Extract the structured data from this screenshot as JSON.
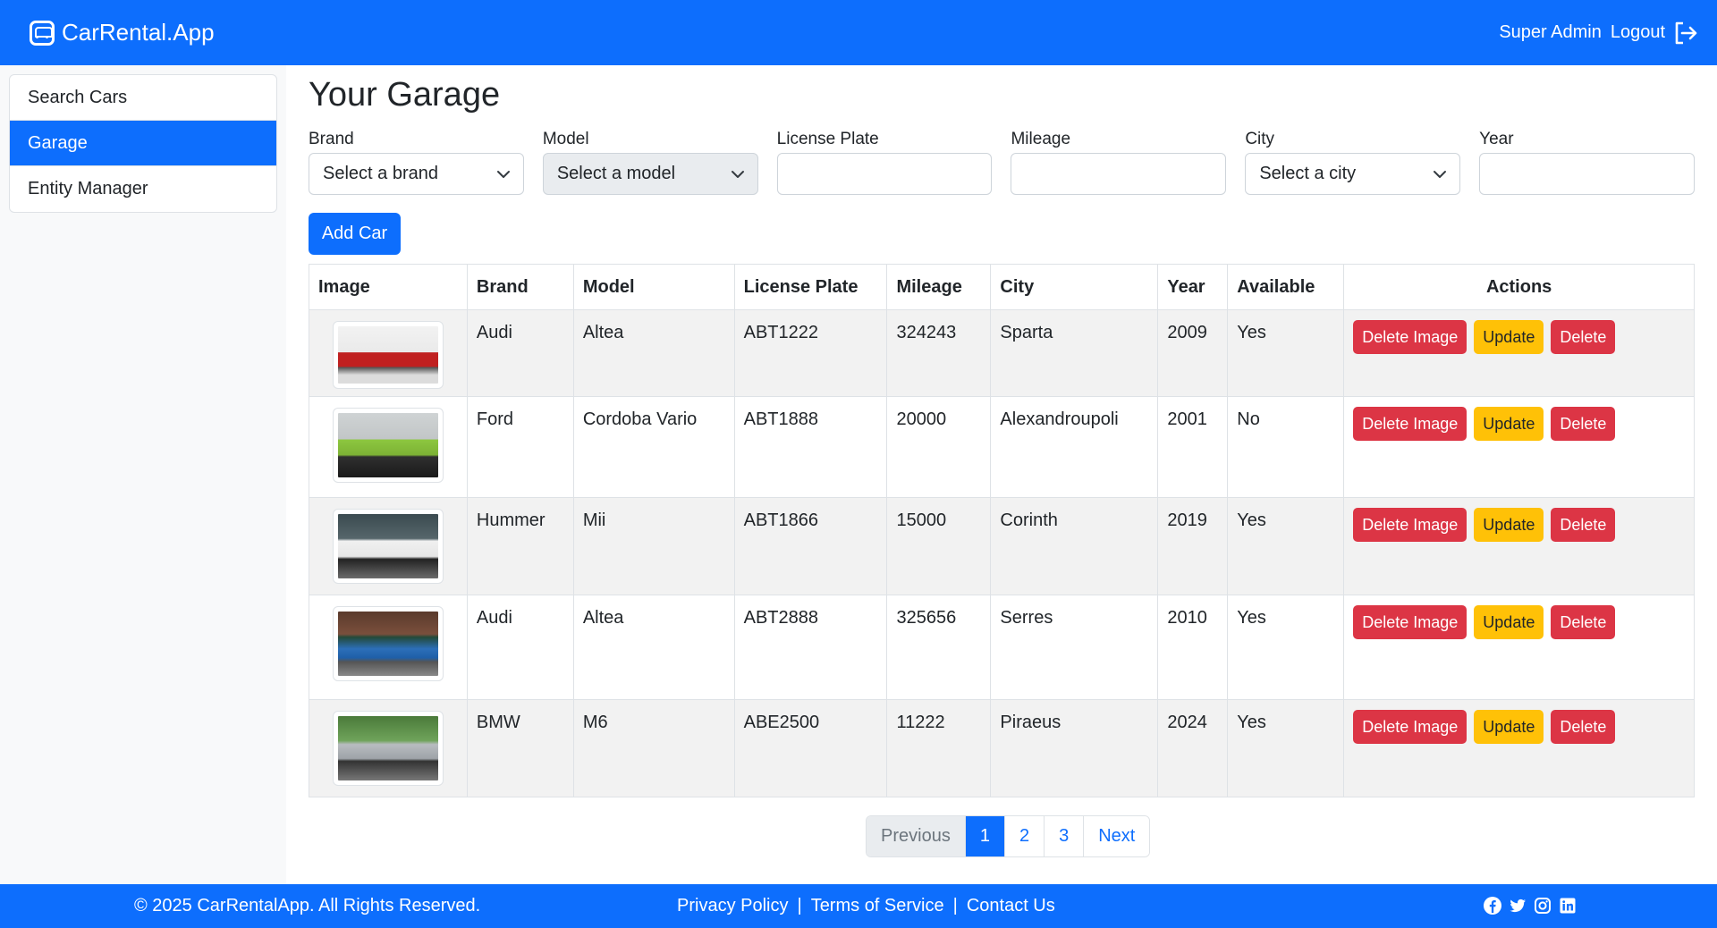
{
  "app": {
    "name": "CarRental.App"
  },
  "nav": {
    "user": "Super Admin",
    "logout": "Logout"
  },
  "sidebar": {
    "items": [
      {
        "label": "Search Cars"
      },
      {
        "label": "Garage"
      },
      {
        "label": "Entity Manager"
      }
    ]
  },
  "page": {
    "title": "Your Garage"
  },
  "filters": {
    "brand": {
      "label": "Brand",
      "value": "Select a brand"
    },
    "model": {
      "label": "Model",
      "value": "Select a model"
    },
    "license_plate": {
      "label": "License Plate",
      "value": ""
    },
    "mileage": {
      "label": "Mileage",
      "value": ""
    },
    "city": {
      "label": "City",
      "value": "Select a city"
    },
    "year": {
      "label": "Year",
      "value": ""
    }
  },
  "add_car": "Add Car",
  "table": {
    "headers": [
      "Image",
      "Brand",
      "Model",
      "License Plate",
      "Mileage",
      "City",
      "Year",
      "Available",
      "Actions"
    ],
    "rows": [
      {
        "brand": "Audi",
        "model": "Altea",
        "plate": "ABT1222",
        "mileage": "324243",
        "city": "Sparta",
        "year": "2009",
        "available": "Yes",
        "image": "red-sports-car"
      },
      {
        "brand": "Ford",
        "model": "Cordoba Vario",
        "plate": "ABT1888",
        "mileage": "20000",
        "city": "Alexandroupoli",
        "year": "2001",
        "available": "No",
        "image": "green-muscle-car"
      },
      {
        "brand": "Hummer",
        "model": "Mii",
        "plate": "ABT1866",
        "mileage": "15000",
        "city": "Corinth",
        "year": "2019",
        "available": "Yes",
        "image": "white-coupe"
      },
      {
        "brand": "Audi",
        "model": "Altea",
        "plate": "ABT2888",
        "mileage": "325656",
        "city": "Serres",
        "year": "2010",
        "available": "Yes",
        "image": "blue-classic-car"
      },
      {
        "brand": "BMW",
        "model": "M6",
        "plate": "ABE2500",
        "mileage": "11222",
        "city": "Piraeus",
        "year": "2024",
        "available": "Yes",
        "image": "silver-sports-car"
      }
    ],
    "actions": {
      "delete_image": "Delete Image",
      "update": "Update",
      "delete": "Delete"
    }
  },
  "pagination": {
    "previous": "Previous",
    "pages": [
      "1",
      "2",
      "3"
    ],
    "next": "Next",
    "current": "1"
  },
  "footer": {
    "copyright": "© 2025 CarRentalApp. All Rights Reserved.",
    "links": [
      "Privacy Policy",
      "Terms of Service",
      "Contact Us"
    ],
    "separator": "|",
    "social_icons": [
      "facebook-icon",
      "twitter-icon",
      "instagram-icon",
      "linkedin-icon"
    ]
  },
  "colors": {
    "primary": "#0d6efd",
    "danger": "#dc3545",
    "warning": "#ffc107",
    "sidebar_bg": "#f8f9fa"
  }
}
